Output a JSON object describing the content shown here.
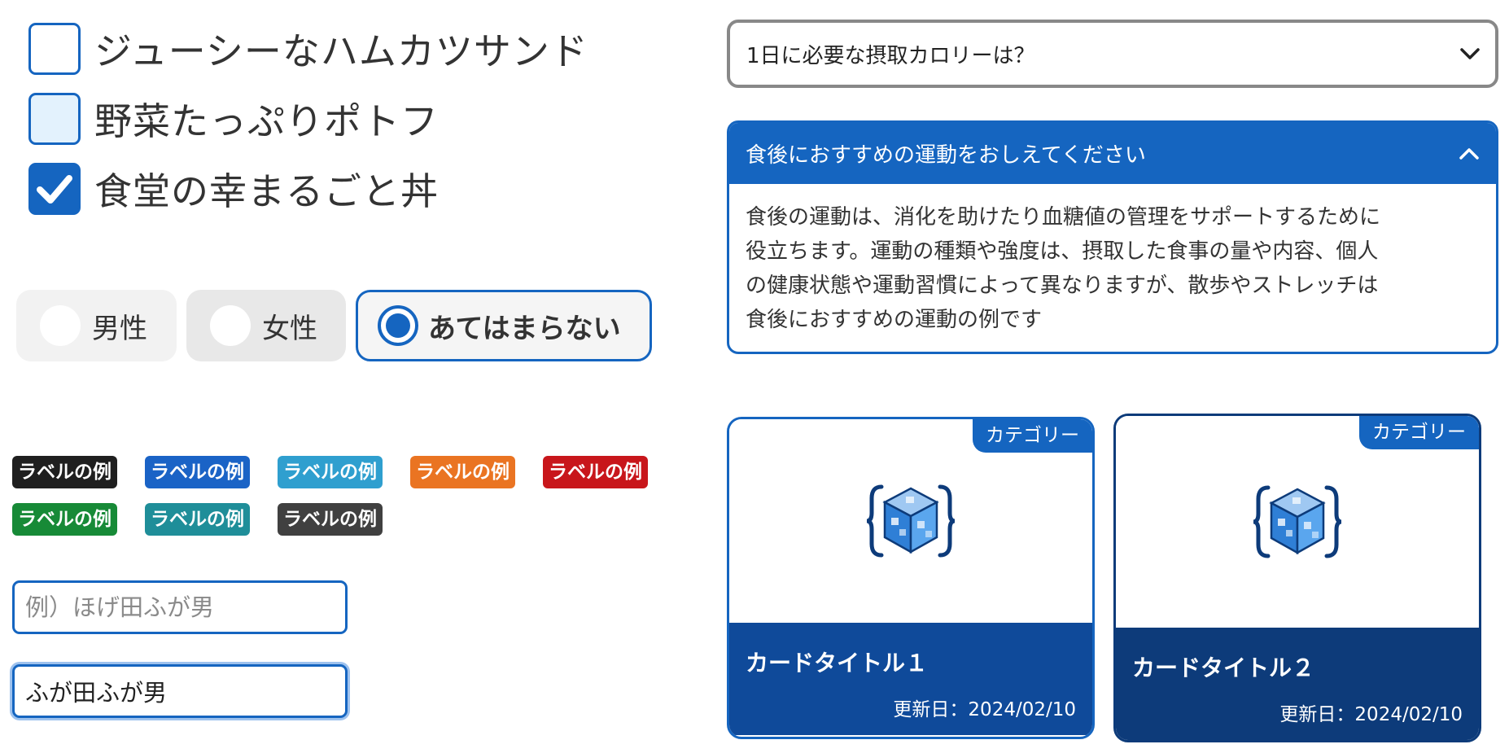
{
  "checkboxes": [
    {
      "label": "ジューシーなハムカツサンド",
      "checked": false,
      "state": "default"
    },
    {
      "label": "野菜たっぷりポトフ",
      "checked": false,
      "state": "hover"
    },
    {
      "label": "食堂の幸まるごと丼",
      "checked": true,
      "state": "checked"
    }
  ],
  "radios": [
    {
      "label": "男性",
      "selected": false
    },
    {
      "label": "女性",
      "selected": false
    },
    {
      "label": "あてはまらない",
      "selected": true
    }
  ],
  "badges": [
    {
      "label": "ラベルの例",
      "color": "#1f1f1f"
    },
    {
      "label": "ラベルの例",
      "color": "#1a63c6"
    },
    {
      "label": "ラベルの例",
      "color": "#2f9fcf"
    },
    {
      "label": "ラベルの例",
      "color": "#ea7422"
    },
    {
      "label": "ラベルの例",
      "color": "#c8161b"
    },
    {
      "label": "ラベルの例",
      "color": "#178a37"
    },
    {
      "label": "ラベルの例",
      "color": "#1f8e99"
    },
    {
      "label": "ラベルの例",
      "color": "#404040"
    }
  ],
  "inputs": {
    "name_placeholder": "例）ほげ田ふが男",
    "name_value": "ふが田ふが男"
  },
  "select": {
    "value": "1日に必要な摂取カロリーは？",
    "icon": "chevron-down-icon"
  },
  "accordion": {
    "title": "食後におすすめの運動をおしえてください",
    "icon": "chevron-up-icon",
    "body_lines": [
      "食後の運動は、消化を助けたり血糖値の管理をサポートするために",
      "役立ちます。運動の種類や強度は、摂取した食事の量や内容、個人",
      "の健康状態や運動習慣によって異なりますが、散歩やストレッチは",
      "食後におすすめの運動の例です"
    ]
  },
  "cards": [
    {
      "category": "カテゴリー",
      "title": "カードタイトル１",
      "date": "更新日：2024/02/10",
      "icon": "cube-logo-icon"
    },
    {
      "category": "カテゴリー",
      "title": "カードタイトル２",
      "date": "更新日：2024/02/10",
      "icon": "cube-logo-icon"
    }
  ],
  "colors": {
    "accent": "#1565c0",
    "card_footer": "#0f4a9a",
    "card_footer_dark": "#0d3b7a"
  }
}
